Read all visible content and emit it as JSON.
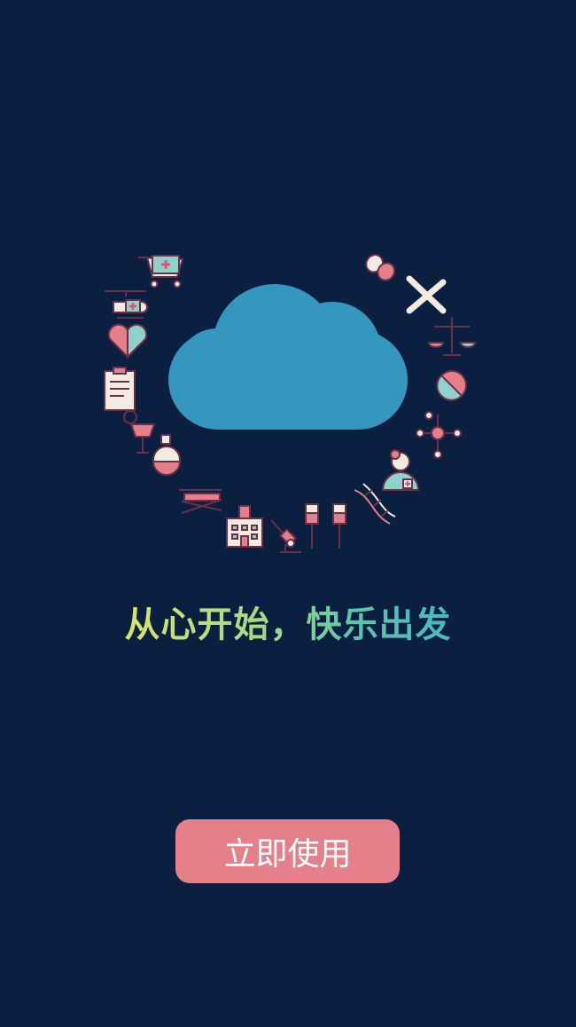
{
  "screen": {
    "background_color": "#0b1f41"
  },
  "illustration": {
    "cloud_color": "#3597bd",
    "icons": [
      "shopping-cart-icon",
      "helicopter-icon",
      "heart-icon",
      "clipboard-icon",
      "stethoscope-icon",
      "flask-icon",
      "hospital-bed-icon",
      "hospital-building-icon",
      "microscope-icon",
      "iv-drip-icon",
      "dna-icon",
      "doctor-icon",
      "molecule-icon",
      "tablet-icon",
      "scale-icon",
      "chromosome-icon",
      "capsule-icon"
    ]
  },
  "slogan": {
    "text": "从心开始，快乐出发",
    "gradient_colors": [
      "#d9e36c",
      "#9fd98a",
      "#5cc6a8",
      "#47b8c9"
    ]
  },
  "cta": {
    "label": "立即使用",
    "color": "#e57f8a"
  }
}
